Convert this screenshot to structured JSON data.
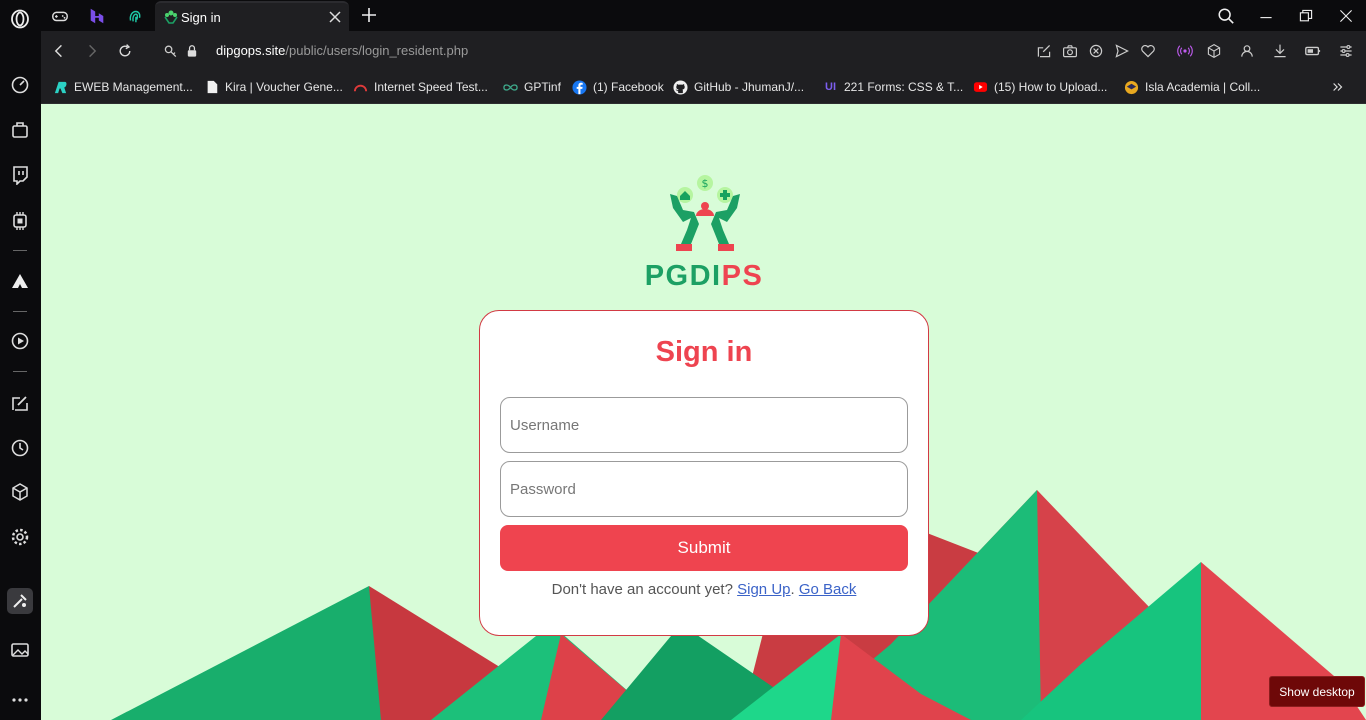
{
  "browser": {
    "tab": {
      "title": "Sign in"
    },
    "url": {
      "host": "dipgops.site",
      "path": "/public/users/login_resident.php"
    },
    "bookmarks": [
      {
        "label": "EWEB Management...",
        "icon": "eweb-icon"
      },
      {
        "label": "Kira | Voucher Gene...",
        "icon": "document-icon"
      },
      {
        "label": "Internet Speed Test...",
        "icon": "speedometer-icon"
      },
      {
        "label": "GPTinf",
        "icon": "infinity-icon"
      },
      {
        "label": "(1) Facebook",
        "icon": "facebook-icon"
      },
      {
        "label": "GitHub - JhumanJ/...",
        "icon": "github-icon"
      },
      {
        "label": "221 Forms: CSS & T...",
        "icon": "ui-icon"
      },
      {
        "label": "(15) How to Upload...",
        "icon": "youtube-icon"
      },
      {
        "label": "Isla Academia | Coll...",
        "icon": "academia-icon"
      }
    ],
    "show_desktop": "Show desktop"
  },
  "page": {
    "brand_part1": "PGDI",
    "brand_part2": "PS",
    "form": {
      "title": "Sign in",
      "username_placeholder": "Username",
      "password_placeholder": "Password",
      "submit_label": "Submit",
      "no_account_text": "Don't have an account yet?",
      "signup_label": "Sign Up",
      "separator": ".",
      "goback_label": "Go Back"
    }
  },
  "colors": {
    "brand_green": "#1ca064",
    "brand_red": "#ee4450",
    "page_bg": "#d8fcd8",
    "submit_bg": "#ef444f"
  }
}
